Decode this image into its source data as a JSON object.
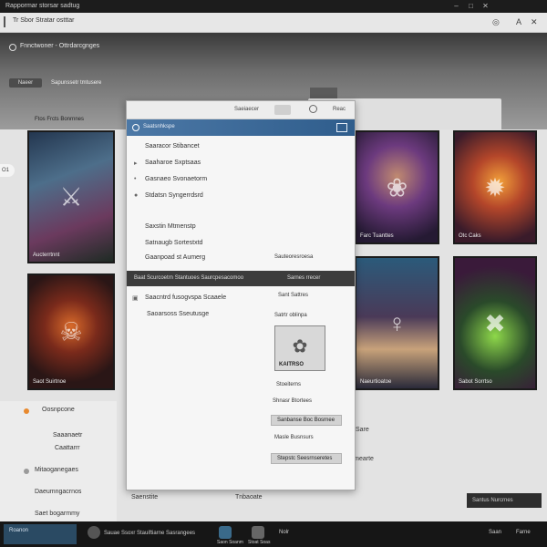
{
  "os_bar": {
    "title": "Rappormar storsar sadtug",
    "controls": [
      "–",
      "□",
      "✕"
    ]
  },
  "app_bar": {
    "tab": "Tr Sbor Stratar ostttar",
    "right_icons": [
      "◎",
      "A",
      "✕"
    ]
  },
  "hero": {
    "brand": "Fnnctwoner - Ottrdarcgnges",
    "pill": "Naeer",
    "subnav": "Sapunssetr tmtusere"
  },
  "section": {
    "title": "Ftos Frcts Bonrnnes",
    "left_chip": "O1"
  },
  "cards": [
    {
      "name": "card-game-1",
      "caption": "Aucterrtnnt",
      "art": "⚔"
    },
    {
      "name": "card-game-2",
      "caption": "Saot Suirtnoe",
      "art": "☠"
    },
    {
      "name": "card-game-3",
      "caption": "Farc Tuanttes",
      "art": "❀"
    },
    {
      "name": "card-game-4",
      "caption": "Otc Caks",
      "art": "✹"
    },
    {
      "name": "card-game-5",
      "caption": "Naeurtioatoe",
      "art": "♀"
    },
    {
      "name": "card-game-6",
      "caption": "Sabot Sorrtso",
      "art": "✖"
    }
  ],
  "panel": {
    "header_label": "Saeiaecer",
    "header_text": "Reac",
    "blue_label": "Saatsnhkspe",
    "items_top": [
      "Saaracor Stibancet",
      "Saaharoe Sxptsaas",
      "Gasnaeo Svonaetorm",
      "Stdatsn Syngerrdsrd"
    ],
    "items_mid": [
      "Saxstin Mtmenstp",
      "Satnaugb Sortestxtd",
      "Gaanpoad st Aumerg"
    ],
    "right_label": "Sauteoresroesa",
    "dark_left": "Baat Scurcoetrn Stantuoes Saurcpesacomoo",
    "dark_right": "Sarnes rrecer",
    "items_low": [
      "Saacntrd fusogvspa Scaaele",
      "Saoarsoss Sseutusge"
    ],
    "right_list": [
      "Sant Sattres",
      "Satrtr oblinpa",
      "Stoeiterns",
      "Shnasr Btortees",
      "Masle Busnsurs"
    ],
    "thumb_label": "KAITRSO",
    "fields": [
      "Sanbanse Boc Bosrnee",
      "Stepstc Seesrnseretes"
    ]
  },
  "right_middle": {
    "t1": "Sare",
    "t2": "Ssmearte"
  },
  "left_lower": {
    "rows": [
      "Oosnpcone",
      "Saaanaetr",
      "Caattarrr",
      "Mitaoganegaes",
      "Daeumngacrnos",
      "Saet bogarmmy"
    ],
    "accent": "#e8892e"
  },
  "bottom": {
    "t1": "Saenstite",
    "t2": "Tnbaoate",
    "chip": "Santus Nurcrnes"
  },
  "taskbar": {
    "start": "Roanon",
    "items": [
      "Sauae Ssoxr",
      "Stauiftiarne Sasrangees",
      "Saon Soanm",
      "Stoat Soas"
    ],
    "tray": [
      "Nolr",
      "Saan",
      "Farne"
    ]
  }
}
